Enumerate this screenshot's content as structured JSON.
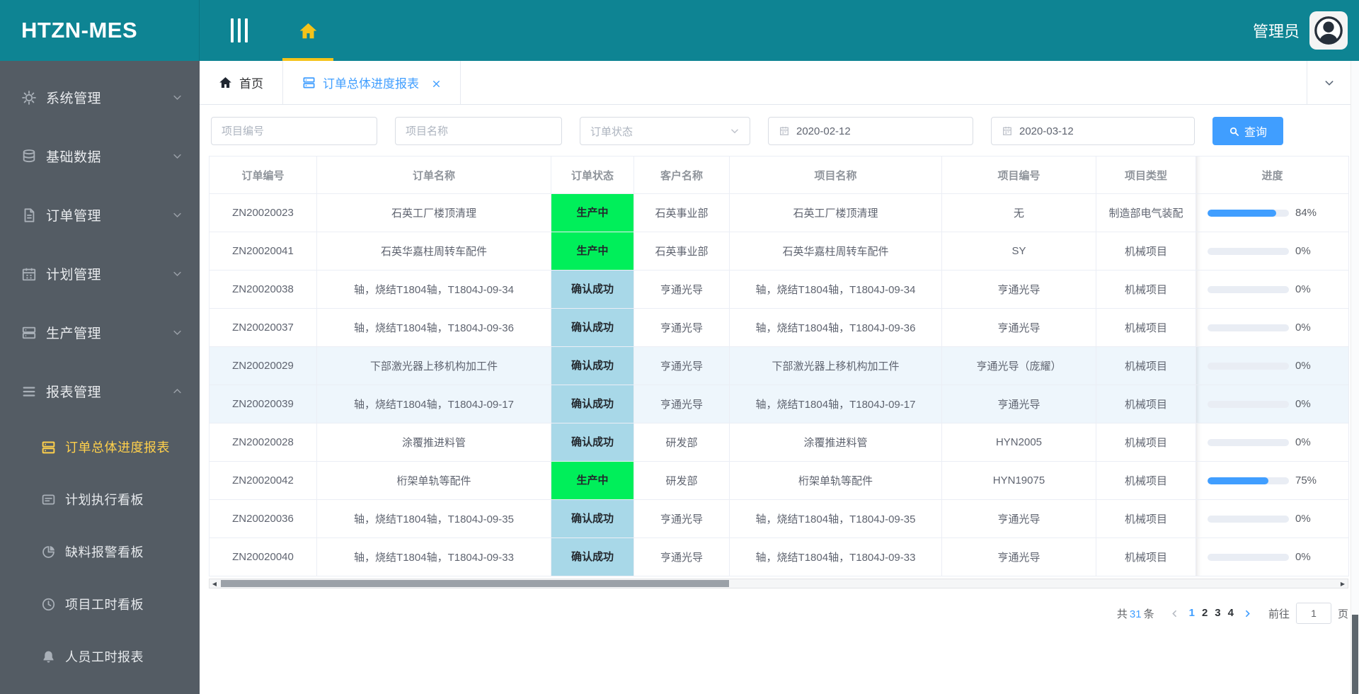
{
  "app": {
    "title": "HTZN-MES",
    "user_name": "管理员"
  },
  "colors": {
    "brand_teal": "#0e8493",
    "accent_blue": "#409eff",
    "menu_active_yellow": "#ffd04b",
    "status_producing_green": "#00ef5a",
    "status_confirmed_blue": "#a8d8e8",
    "progress_track": "#e9edf4"
  },
  "sidebar": {
    "items": [
      {
        "name": "system-management",
        "label": "系统管理",
        "icon": "gear-icon",
        "expanded": false
      },
      {
        "name": "basic-data",
        "label": "基础数据",
        "icon": "database-icon",
        "expanded": false
      },
      {
        "name": "order-management",
        "label": "订单管理",
        "icon": "order-document-icon",
        "expanded": false
      },
      {
        "name": "plan-management",
        "label": "计划管理",
        "icon": "calendar-icon",
        "expanded": false
      },
      {
        "name": "production-management",
        "label": "生产管理",
        "icon": "production-list-icon",
        "expanded": false
      },
      {
        "name": "report-management",
        "label": "报表管理",
        "icon": "report-menu-icon",
        "expanded": true
      }
    ],
    "subitems": [
      {
        "name": "order-overall-progress-report",
        "label": "订单总体进度报表",
        "icon": "order-progress-report-icon",
        "active": true
      },
      {
        "name": "plan-execution-board",
        "label": "计划执行看板",
        "icon": "plan-board-icon",
        "active": false
      },
      {
        "name": "material-shortage-alarm-board",
        "label": "缺料报警看板",
        "icon": "shortage-pie-icon",
        "active": false
      },
      {
        "name": "project-hours-board",
        "label": "项目工时看板",
        "icon": "hours-clock-icon",
        "active": false
      },
      {
        "name": "personnel-hours-report",
        "label": "人员工时报表",
        "icon": "personnel-bell-icon",
        "active": false
      }
    ]
  },
  "tabs": [
    {
      "label": "首页",
      "active": false,
      "closable": false
    },
    {
      "label": "订单总体进度报表",
      "active": true,
      "closable": true
    }
  ],
  "filters": {
    "project_code_placeholder": "项目编号",
    "project_name_placeholder": "项目名称",
    "order_status_placeholder": "订单状态",
    "start_date": "2020-02-12",
    "end_date": "2020-03-12",
    "search_label": "查询"
  },
  "table": {
    "columns": [
      "订单编号",
      "订单名称",
      "订单状态",
      "客户名称",
      "项目名称",
      "项目编号",
      "项目类型",
      "进度"
    ],
    "rows": [
      {
        "order_no": "ZN20020023",
        "order_name": "石英工厂楼顶清理",
        "status": "生产中",
        "status_type": "producing",
        "customer": "石英事业部",
        "project_name": "石英工厂楼顶清理",
        "project_code": "无",
        "project_type": "制造部电气装配",
        "progress": 84,
        "highlight": false
      },
      {
        "order_no": "ZN20020041",
        "order_name": "石英华嘉柱周转车配件",
        "status": "生产中",
        "status_type": "producing",
        "customer": "石英事业部",
        "project_name": "石英华嘉柱周转车配件",
        "project_code": "SY",
        "project_type": "机械项目",
        "progress": 0,
        "highlight": false
      },
      {
        "order_no": "ZN20020038",
        "order_name": "轴，烧结T1804轴，T1804J-09-34",
        "status": "确认成功",
        "status_type": "confirmed",
        "customer": "亨通光导",
        "project_name": "轴，烧结T1804轴，T1804J-09-34",
        "project_code": "亨通光导",
        "project_type": "机械项目",
        "progress": 0,
        "highlight": false
      },
      {
        "order_no": "ZN20020037",
        "order_name": "轴，烧结T1804轴，T1804J-09-36",
        "status": "确认成功",
        "status_type": "confirmed",
        "customer": "亨通光导",
        "project_name": "轴，烧结T1804轴，T1804J-09-36",
        "project_code": "亨通光导",
        "project_type": "机械项目",
        "progress": 0,
        "highlight": false
      },
      {
        "order_no": "ZN20020029",
        "order_name": "下部激光器上移机构加工件",
        "status": "确认成功",
        "status_type": "confirmed",
        "customer": "亨通光导",
        "project_name": "下部激光器上移机构加工件",
        "project_code": "亨通光导（庞耀）",
        "project_type": "机械项目",
        "progress": 0,
        "highlight": true
      },
      {
        "order_no": "ZN20020039",
        "order_name": "轴，烧结T1804轴，T1804J-09-17",
        "status": "确认成功",
        "status_type": "confirmed",
        "customer": "亨通光导",
        "project_name": "轴，烧结T1804轴，T1804J-09-17",
        "project_code": "亨通光导",
        "project_type": "机械项目",
        "progress": 0,
        "highlight": true
      },
      {
        "order_no": "ZN20020028",
        "order_name": "涂覆推进料管",
        "status": "确认成功",
        "status_type": "confirmed",
        "customer": "研发部",
        "project_name": "涂覆推进料管",
        "project_code": "HYN2005",
        "project_type": "机械项目",
        "progress": 0,
        "highlight": false
      },
      {
        "order_no": "ZN20020042",
        "order_name": "桁架单轨等配件",
        "status": "生产中",
        "status_type": "producing",
        "customer": "研发部",
        "project_name": "桁架单轨等配件",
        "project_code": "HYN19075",
        "project_type": "机械项目",
        "progress": 75,
        "highlight": false
      },
      {
        "order_no": "ZN20020036",
        "order_name": "轴，烧结T1804轴，T1804J-09-35",
        "status": "确认成功",
        "status_type": "confirmed",
        "customer": "亨通光导",
        "project_name": "轴，烧结T1804轴，T1804J-09-35",
        "project_code": "亨通光导",
        "project_type": "机械项目",
        "progress": 0,
        "highlight": false
      },
      {
        "order_no": "ZN20020040",
        "order_name": "轴，烧结T1804轴，T1804J-09-33",
        "status": "确认成功",
        "status_type": "confirmed",
        "customer": "亨通光导",
        "project_name": "轴，烧结T1804轴，T1804J-09-33",
        "project_code": "亨通光导",
        "project_type": "机械项目",
        "progress": 0,
        "highlight": false
      }
    ]
  },
  "pagination": {
    "total_prefix": "共",
    "total": "31",
    "total_suffix": "条",
    "pages": [
      "1",
      "2",
      "3",
      "4"
    ],
    "active_page": "1",
    "goto_label": "前往",
    "goto_value": "1",
    "page_unit": "页"
  }
}
